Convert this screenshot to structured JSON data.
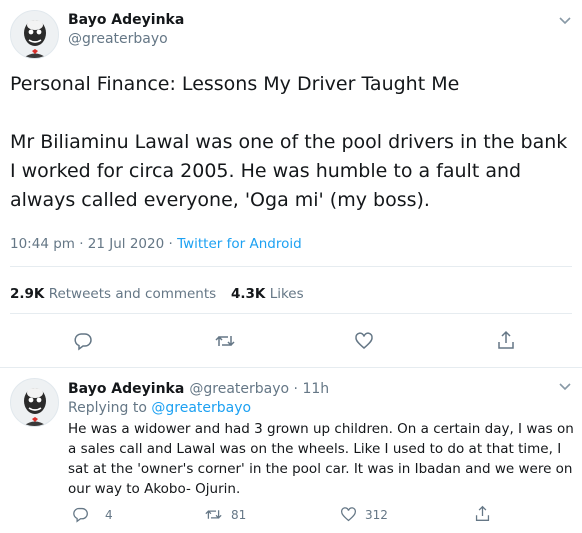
{
  "tweet": {
    "author_name": "Bayo Adeyinka",
    "author_handle": "@greaterbayo",
    "text": "Personal Finance: Lessons My Driver Taught Me\n\nMr Biliaminu Lawal was one of the pool drivers in the bank I worked for circa 2005. He was humble to a fault and always called everyone, 'Oga mi' (my boss).",
    "time": "10:44 pm · 21 Jul 2020 · ",
    "source": "Twitter for Android",
    "retweets_count": "2.9K",
    "retweets_label": "Retweets and comments",
    "likes_count": "4.3K",
    "likes_label": "Likes"
  },
  "actions": {
    "icons": [
      "reply-icon",
      "retweet-icon",
      "like-icon",
      "share-icon"
    ]
  },
  "reply": {
    "author_name": "Bayo Adeyinka",
    "author_handle": "@greaterbayo · 11h",
    "replying_prefix": "Replying to ",
    "replying_to": "@greaterbayo",
    "text": "He was a widower and had 3 grown up children. On a certain day, I was on a sales call and Lawal was on the wheels. Like I used to do at that time, I sat at the 'owner's corner' in the pool car. It was in Ibadan and we were on our way to Akobo- Ojurin.",
    "reply_count": "4",
    "retweet_count": "81",
    "like_count": "312"
  },
  "colors": {
    "accent": "#1da1f2",
    "muted": "#657786",
    "text": "#14171a",
    "divider": "#e6ecf0"
  }
}
